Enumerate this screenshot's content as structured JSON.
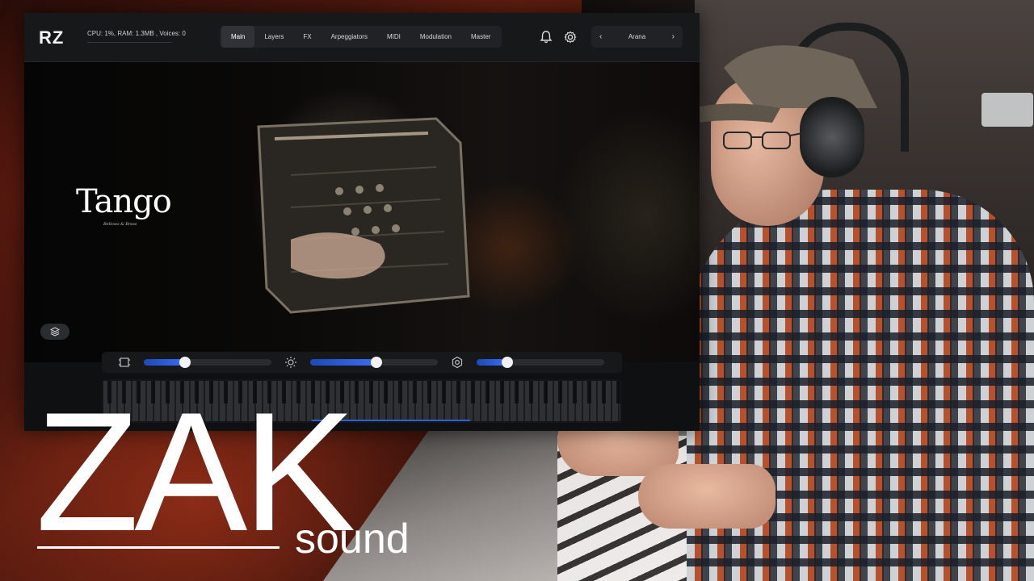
{
  "plugin": {
    "logo": "RZ",
    "status": "CPU: 1%, RAM: 1.3MB , Voices: 0",
    "tabs": [
      {
        "label": "Main",
        "active": true
      },
      {
        "label": "Layers",
        "active": false
      },
      {
        "label": "FX",
        "active": false
      },
      {
        "label": "Arpeggiators",
        "active": false
      },
      {
        "label": "MIDI",
        "active": false
      },
      {
        "label": "Modulation",
        "active": false
      },
      {
        "label": "Master",
        "active": false
      }
    ],
    "header_icons": [
      "bell-icon",
      "gear-icon"
    ],
    "preset": {
      "prev": "‹",
      "name": "Arana",
      "next": "›"
    },
    "instrument": {
      "title": "Tango",
      "subtitle": "Bellows & Brass"
    },
    "controls": [
      {
        "icon": "frame-icon",
        "value": 0.32
      },
      {
        "icon": "sun-icon",
        "value": 0.52
      },
      {
        "icon": "hexagon-icon",
        "value": 0.24
      }
    ],
    "accent_color": "#3c6cf0"
  },
  "brand": {
    "main": "ZAK",
    "sub": "sound"
  }
}
